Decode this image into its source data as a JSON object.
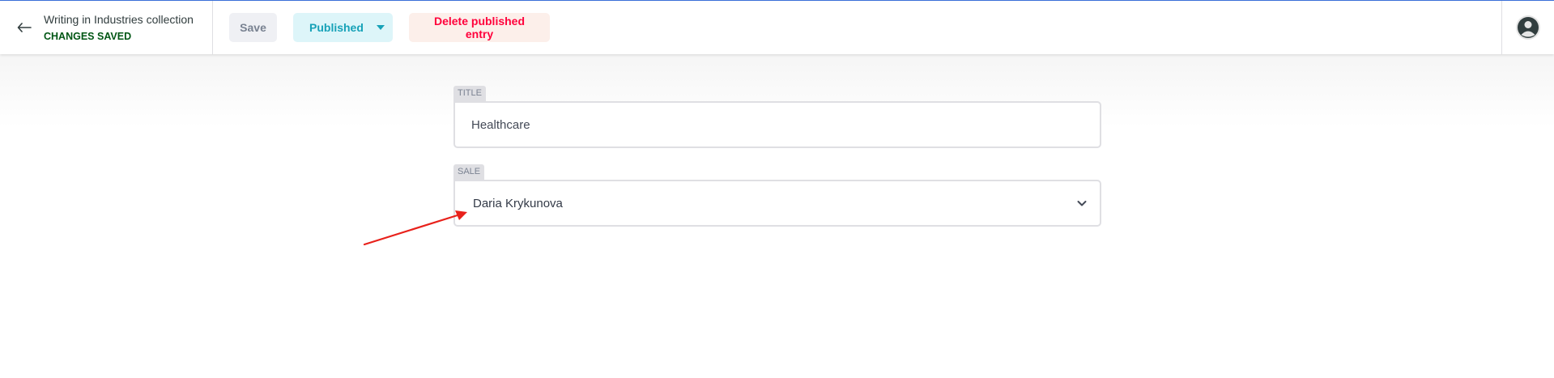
{
  "header": {
    "back_icon": "arrow-left-icon",
    "collection_title": "Writing in Industries collection",
    "save_status": "CHANGES SAVED",
    "save_status_color": "#005614"
  },
  "toolbar": {
    "save_label": "Save",
    "publish_label": "Published",
    "delete_label": "Delete published entry"
  },
  "user": {
    "avatar_icon": "user-avatar-icon"
  },
  "fields": {
    "title": {
      "label": "TITLE",
      "value": "Healthcare"
    },
    "sale": {
      "label": "SALE",
      "value": "Daria Krykunova",
      "dropdown_icon": "chevron-down-icon"
    }
  },
  "annotation": {
    "icon": "red-arrow-pointer",
    "color": "#e8211b"
  }
}
